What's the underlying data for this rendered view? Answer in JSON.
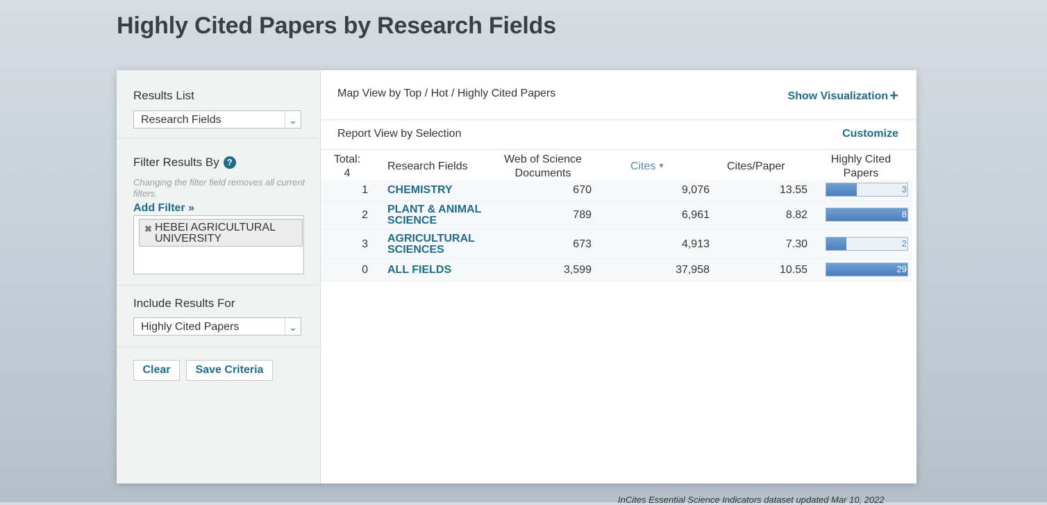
{
  "page": {
    "title": "Highly Cited Papers by Research Fields"
  },
  "sidebar": {
    "results_list_label": "Results List",
    "results_list_value": "Research Fields",
    "filter_label": "Filter Results By",
    "filter_hint": "Changing the filter field removes all current filters.",
    "add_filter": "Add Filter »",
    "filter_chip": "HEBEI AGRICULTURAL UNIVERSITY",
    "include_label": "Include Results For",
    "include_value": "Highly Cited Papers",
    "clear_button": "Clear",
    "save_button": "Save Criteria"
  },
  "main": {
    "map_view": "Map View by Top / Hot / Highly Cited Papers",
    "show_visualization": "Show Visualization",
    "report_view": "Report View by Selection",
    "customize": "Customize",
    "table": {
      "headers": {
        "total_label": "Total:",
        "total_value": "4",
        "field": "Research Fields",
        "docs": "Web of Science Documents",
        "cites": "Cites",
        "cites_per_paper": "Cites/Paper",
        "hcp": "Highly Cited Papers"
      },
      "rows": [
        {
          "rank": "1",
          "field": "CHEMISTRY",
          "docs": "670",
          "cites": "9,076",
          "cpp": "13.55",
          "hcp_label": "3",
          "hcp_fill": 0.38
        },
        {
          "rank": "2",
          "field": "PLANT & ANIMAL SCIENCE",
          "docs": "789",
          "cites": "6,961",
          "cpp": "8.82",
          "hcp_label": "8",
          "hcp_fill": 1.0
        },
        {
          "rank": "3",
          "field": "AGRICULTURAL SCIENCES",
          "docs": "673",
          "cites": "4,913",
          "cpp": "7.30",
          "hcp_label": "2",
          "hcp_fill": 0.25
        },
        {
          "rank": "0",
          "field": "ALL FIELDS",
          "docs": "3,599",
          "cites": "37,958",
          "cpp": "10.55",
          "hcp_label": "29",
          "hcp_fill": 1.0
        }
      ]
    }
  },
  "footer": {
    "note": "InCites Essential Science Indicators dataset updated Mar 10, 2022"
  },
  "colors": {
    "link": "#1e6c8a",
    "meter_fill": "#4b7fbf"
  }
}
